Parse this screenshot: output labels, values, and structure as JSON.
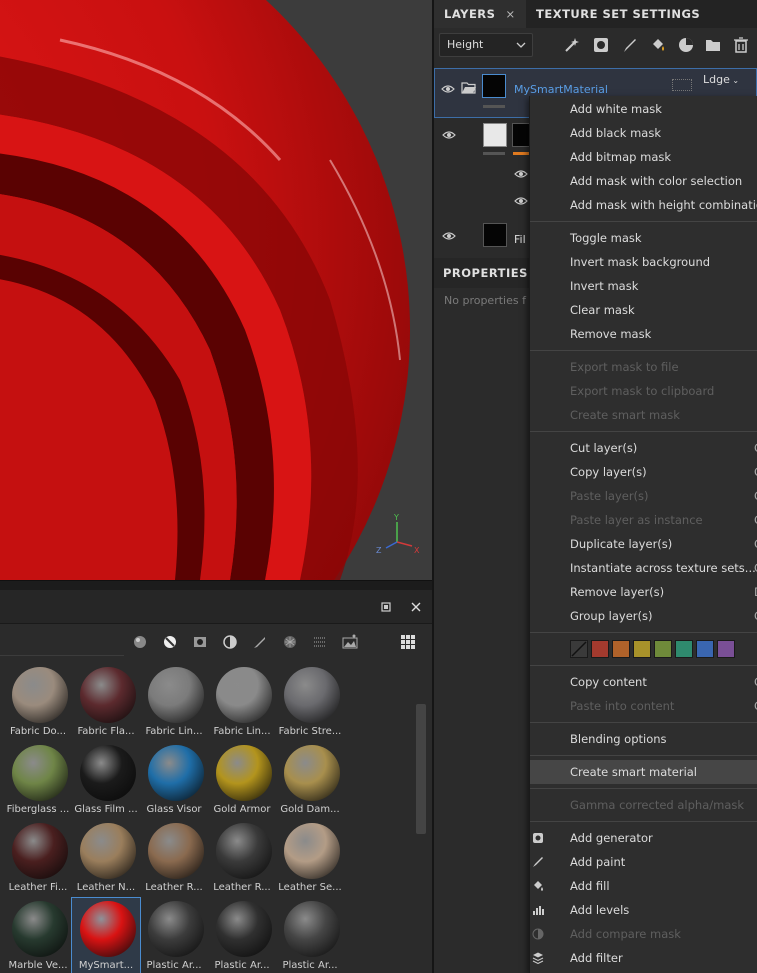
{
  "viewport": {
    "axis": {
      "y": "Y",
      "x": "X",
      "z": "Z"
    }
  },
  "layers_panel": {
    "tabs": [
      {
        "label": "LAYERS",
        "close": "×"
      },
      {
        "label": "TEXTURE SET SETTINGS"
      }
    ],
    "channel_dropdown": {
      "value": "Height"
    },
    "layers": [
      {
        "name": "MySmartMaterial",
        "blend": "Ldge",
        "selected": true
      },
      {
        "name": ""
      },
      {
        "name": "Fil"
      }
    ],
    "properties": {
      "title": "PROPERTIES",
      "empty_text": "No properties f"
    }
  },
  "context_menu": {
    "groups": [
      [
        {
          "label": "Add white mask"
        },
        {
          "label": "Add black mask"
        },
        {
          "label": "Add bitmap mask"
        },
        {
          "label": "Add mask with color selection"
        },
        {
          "label": "Add mask with height combination"
        }
      ],
      [
        {
          "label": "Toggle mask"
        },
        {
          "label": "Invert mask background"
        },
        {
          "label": "Invert mask"
        },
        {
          "label": "Clear mask"
        },
        {
          "label": "Remove mask"
        }
      ],
      [
        {
          "label": "Export mask to file",
          "disabled": true
        },
        {
          "label": "Export mask to clipboard",
          "disabled": true
        },
        {
          "label": "Create smart mask",
          "disabled": true
        }
      ],
      [
        {
          "label": "Cut layer(s)",
          "shortcut": "C"
        },
        {
          "label": "Copy layer(s)",
          "shortcut": "C"
        },
        {
          "label": "Paste layer(s)",
          "disabled": true,
          "shortcut": "C"
        },
        {
          "label": "Paste layer as instance",
          "disabled": true,
          "shortcut": "C"
        },
        {
          "label": "Duplicate layer(s)",
          "shortcut": "C"
        },
        {
          "label": "Instantiate across texture sets...",
          "shortcut": "C"
        },
        {
          "label": "Remove layer(s)",
          "shortcut": "D"
        },
        {
          "label": "Group layer(s)",
          "shortcut": "C"
        }
      ]
    ],
    "color_tags": [
      "#3a3a3a",
      "#a33a2e",
      "#b0622a",
      "#a8922a",
      "#6f8a3a",
      "#2f8a6e",
      "#3a66b0",
      "#7a4f96"
    ],
    "content": [
      {
        "label": "Copy content",
        "shortcut": "C"
      },
      {
        "label": "Paste into content",
        "disabled": true,
        "shortcut": "C"
      }
    ],
    "blending": {
      "label": "Blending options"
    },
    "smart": {
      "label": "Create smart material"
    },
    "gamma": {
      "label": "Gamma corrected alpha/mask",
      "disabled": true
    },
    "add_items": [
      {
        "label": "Add generator",
        "icon": "generator-icon"
      },
      {
        "label": "Add paint",
        "icon": "brush-icon"
      },
      {
        "label": "Add fill",
        "icon": "fill-bucket-icon"
      },
      {
        "label": "Add levels",
        "icon": "levels-icon"
      },
      {
        "label": "Add compare mask",
        "icon": "compare-mask-icon",
        "disabled": true
      },
      {
        "label": "Add filter",
        "icon": "filter-icon"
      }
    ]
  },
  "shelf": {
    "materials": [
      {
        "label": "Fabric Do...",
        "color": "#9a8b7d"
      },
      {
        "label": "Fabric Fla...",
        "color": "#5c2a2e"
      },
      {
        "label": "Fabric Lin...",
        "color": "#7b7b7b"
      },
      {
        "label": "Fabric Lin...",
        "color": "#8a8a8a"
      },
      {
        "label": "Fabric Stre...",
        "color": "#6a6a6e"
      },
      {
        "label": "Fiberglass ...",
        "color": "#6f8547"
      },
      {
        "label": "Glass Film ...",
        "color": "#1b1b1b"
      },
      {
        "label": "Glass Visor",
        "color": "#1f6ea8"
      },
      {
        "label": "Gold Armor",
        "color": "#b3941d"
      },
      {
        "label": "Gold Dam...",
        "color": "#a88f4d"
      },
      {
        "label": "Leather Fi...",
        "color": "#4a1f1f"
      },
      {
        "label": "Leather N...",
        "color": "#9a7e5c"
      },
      {
        "label": "Leather R...",
        "color": "#8a6a4f"
      },
      {
        "label": "Leather R...",
        "color": "#3a3a3a"
      },
      {
        "label": "Leather Se...",
        "color": "#b39c86"
      },
      {
        "label": "Marble Ve...",
        "color": "#273a2f"
      },
      {
        "label": "MySmart...",
        "color": "#d91313",
        "selected": true
      },
      {
        "label": "Plastic Ar...",
        "color": "#3c3c3c"
      },
      {
        "label": "Plastic Ar...",
        "color": "#303030"
      },
      {
        "label": "Plastic Ar...",
        "color": "#454545"
      }
    ]
  }
}
